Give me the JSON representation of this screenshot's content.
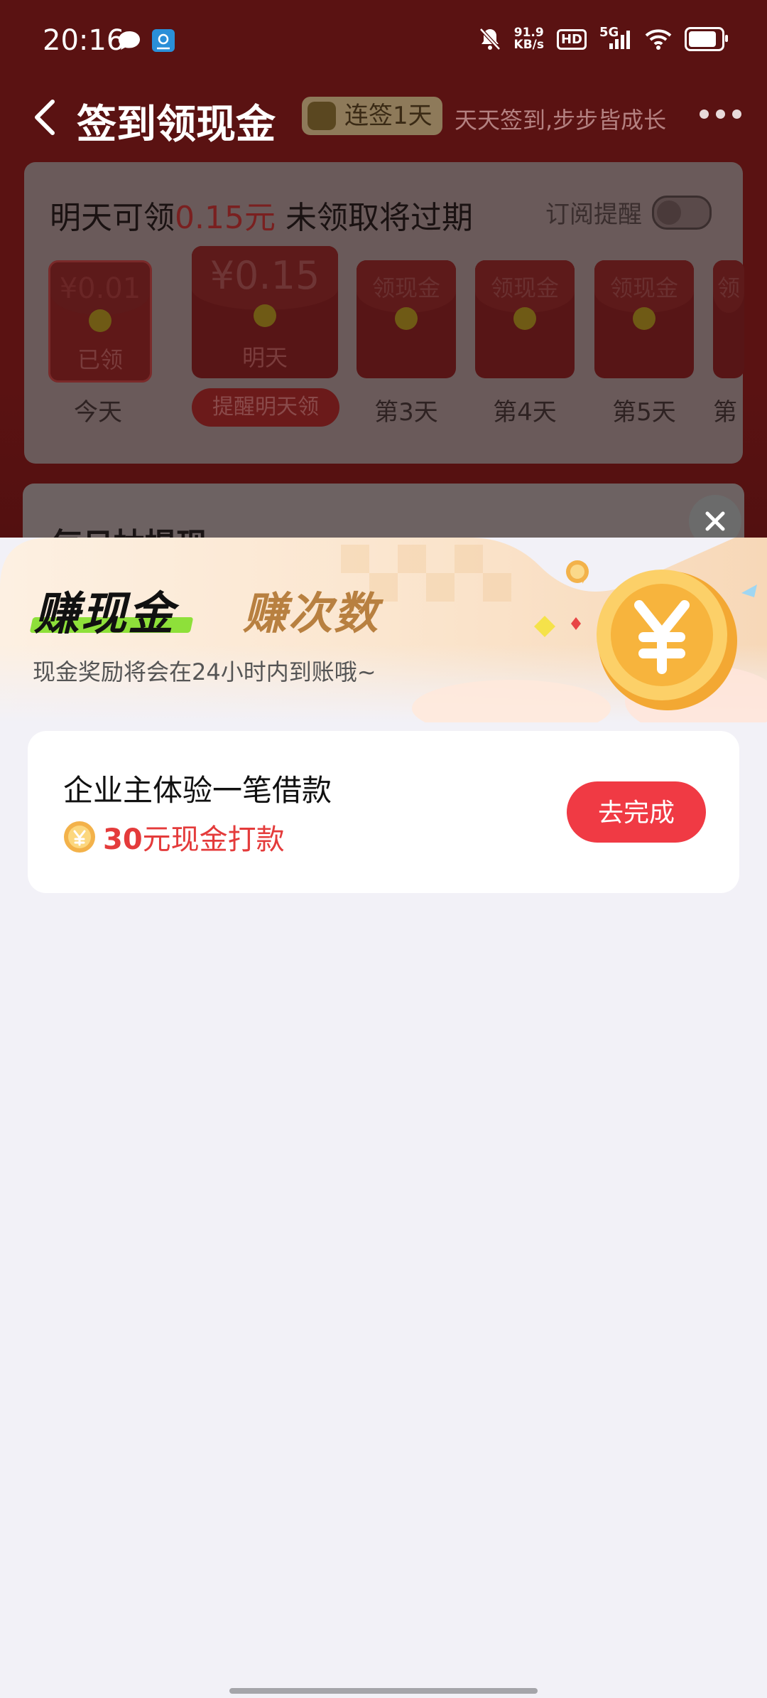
{
  "status_bar": {
    "time": "20:16",
    "left_icons": [
      "chat-bubble-icon",
      "app-notification-icon"
    ],
    "net_speed_value": "91.9",
    "net_speed_unit": "KB/s",
    "hd_label": "HD",
    "network": "5G",
    "icons": [
      "mute-bell-icon",
      "signal-icon",
      "wifi-icon",
      "battery-icon"
    ]
  },
  "header": {
    "title": "签到领现金",
    "streak_badge": "连签1天",
    "slogan": "天天签到,步步皆成长"
  },
  "signin_card": {
    "headline_prefix": "明天可领",
    "headline_amount": "0.15元",
    "headline_suffix": " 未领取将过期",
    "subscribe_label": "订阅提醒",
    "envelopes": [
      {
        "top": "¥0.01",
        "bottom": "已领",
        "day": "今天"
      },
      {
        "top": "¥0.15",
        "bottom": "明天",
        "day": "提醒明天领"
      },
      {
        "top": "领现金",
        "bottom": "",
        "day": "第3天"
      },
      {
        "top": "领现金",
        "bottom": "",
        "day": "第4天"
      },
      {
        "top": "领现金",
        "bottom": "",
        "day": "第5天"
      },
      {
        "top": "领",
        "bottom": "",
        "day": "第"
      }
    ]
  },
  "withdraw_card": {
    "title": "每日抽提现"
  },
  "panel": {
    "tab_active": "赚现金",
    "tab_inactive": "赚次数",
    "subtitle": "现金奖励将会在24小时内到账哦~",
    "task": {
      "name": "企业主体验一笔借款",
      "reward_amount": "30",
      "reward_text": "元现金打款",
      "button": "去完成"
    }
  },
  "colors": {
    "accent_red": "#f03a44",
    "reward_red": "#e43b3b",
    "tab_gold": "#b88040",
    "tab_highlight": "#8ee03a"
  }
}
